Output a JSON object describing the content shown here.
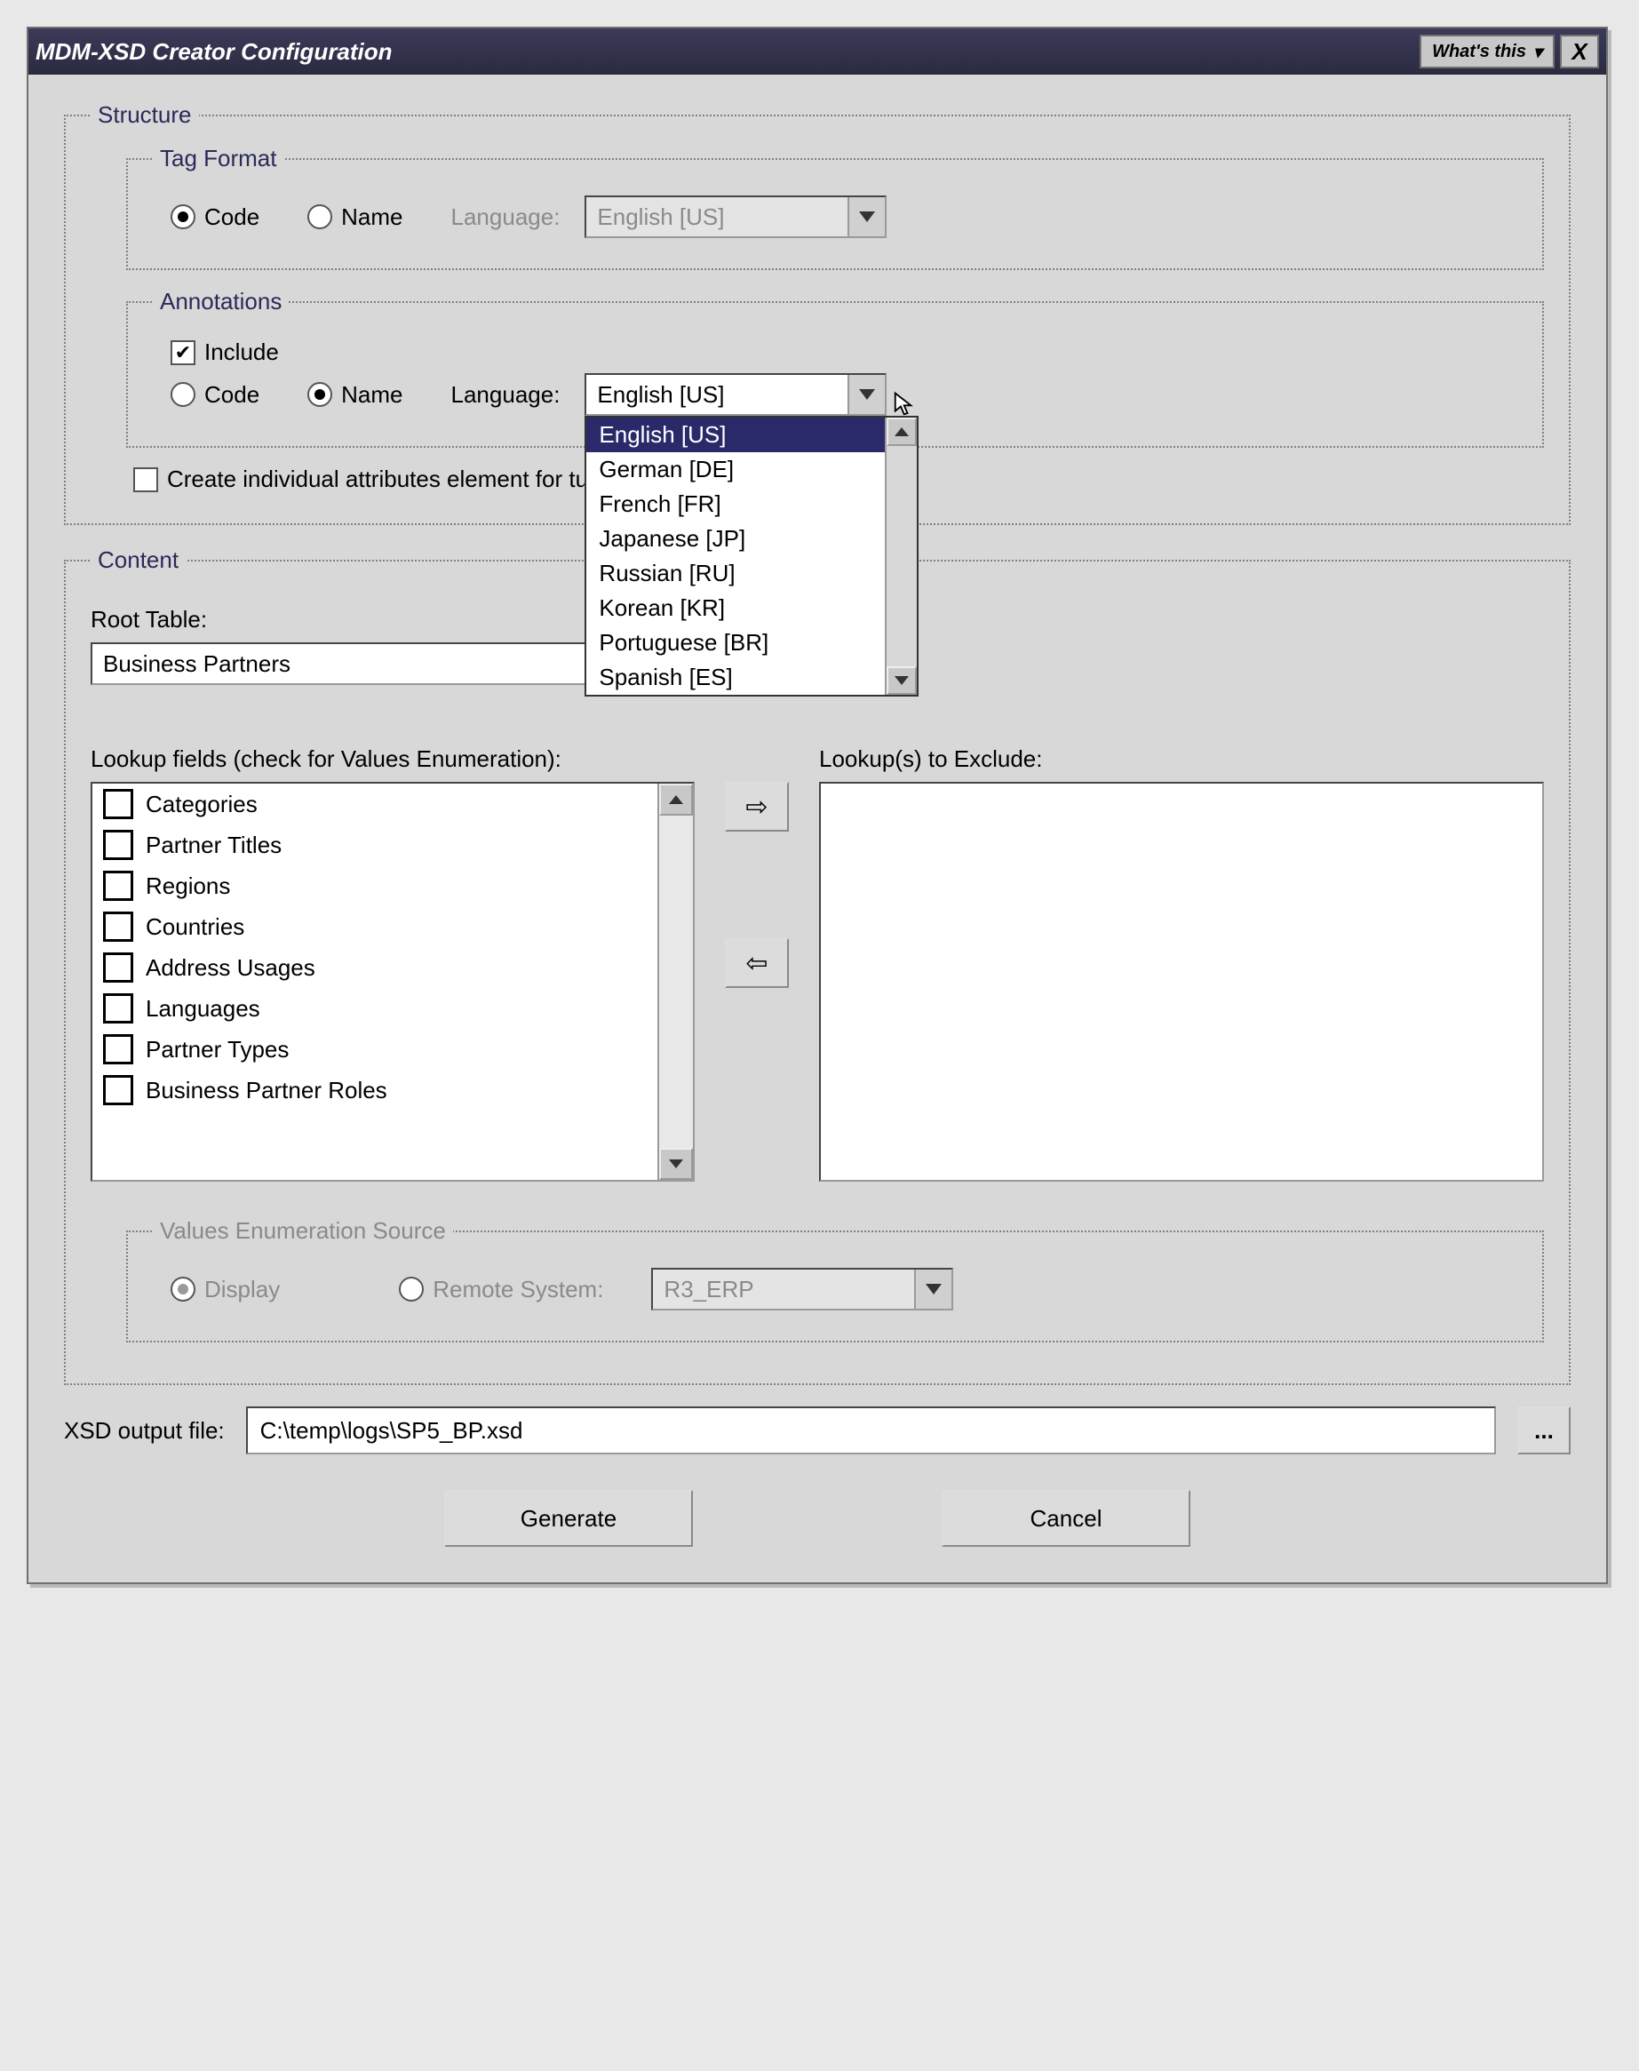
{
  "window": {
    "title": "MDM-XSD Creator Configuration"
  },
  "structure": {
    "legend": "Structure",
    "tag_format": {
      "legend": "Tag Format",
      "code_label": "Code",
      "name_label": "Name",
      "selected": "code",
      "language_label": "Language:",
      "language_value": "English [US]"
    },
    "annotations": {
      "legend": "Annotations",
      "include_label": "Include",
      "include_checked": true,
      "code_label": "Code",
      "name_label": "Name",
      "selected": "name",
      "language_label": "Language:",
      "language_value": "English [US]",
      "language_options": [
        "English [US]",
        "German [DE]",
        "French [FR]",
        "Japanese [JP]",
        "Russian [RU]",
        "Korean [KR]",
        "Portuguese [BR]",
        "Spanish [ES]"
      ]
    },
    "create_individual_label": "Create individual attributes element for tuples"
  },
  "content": {
    "legend": "Content",
    "root_table_label": "Root Table:",
    "root_table_value": "Business Partners",
    "lookup_fields_label": "Lookup fields (check for Values Enumeration):",
    "lookups_exclude_label": "Lookup(s) to Exclude:",
    "lookup_items": [
      "Categories",
      "Partner Titles",
      "Regions",
      "Countries",
      "Address Usages",
      "Languages",
      "Partner Types",
      "Business Partner Roles"
    ],
    "values_enum": {
      "legend": "Values Enumeration Source",
      "display_label": "Display",
      "remote_label": "Remote System:",
      "selected": "display",
      "remote_value": "R3_ERP"
    }
  },
  "output": {
    "label": "XSD output file:",
    "value": "C:\\temp\\logs\\SP5_BP.xsd",
    "browse": "..."
  },
  "buttons": {
    "generate": "Generate",
    "cancel": "Cancel"
  },
  "titlebar_buttons": {
    "help": "What's this",
    "close": "X"
  },
  "arrows": {
    "right": "⇨",
    "left": "⇦"
  }
}
